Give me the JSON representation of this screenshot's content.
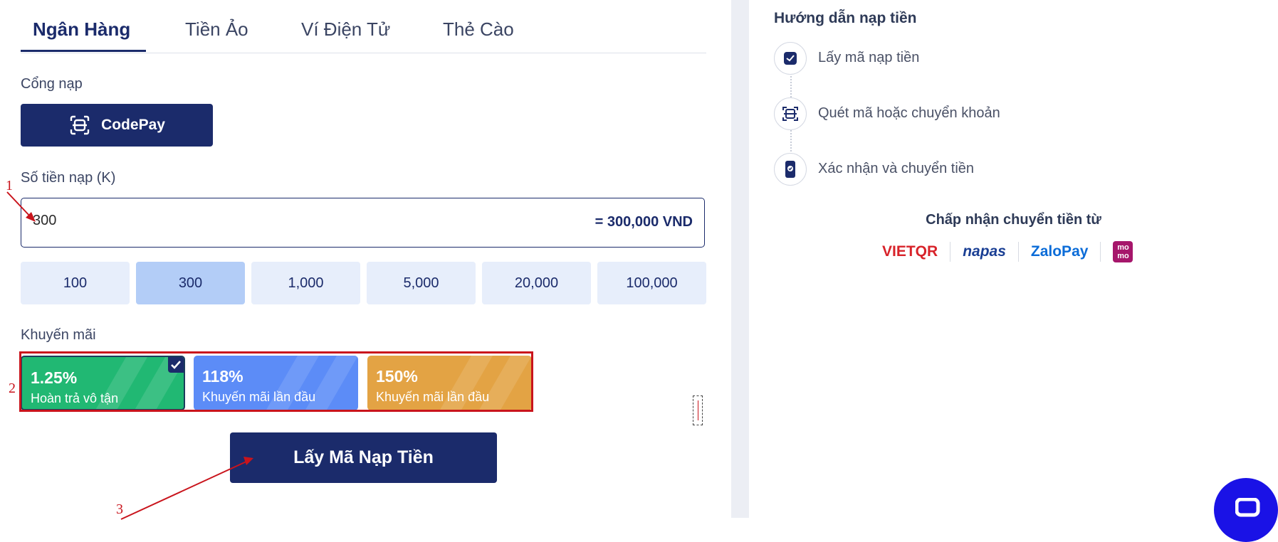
{
  "tabs": [
    {
      "label": "Ngân Hàng",
      "active": true
    },
    {
      "label": "Tiền Ảo",
      "active": false
    },
    {
      "label": "Ví Điện Tử",
      "active": false
    },
    {
      "label": "Thẻ Cào",
      "active": false
    }
  ],
  "gateway": {
    "label": "Cổng nạp",
    "button": "CodePay"
  },
  "amount": {
    "label": "Số tiền nạp (K)",
    "value": "300",
    "converted": "= 300,000 VND"
  },
  "presets": [
    {
      "label": "100",
      "selected": false
    },
    {
      "label": "300",
      "selected": true
    },
    {
      "label": "1,000",
      "selected": false
    },
    {
      "label": "5,000",
      "selected": false
    },
    {
      "label": "20,000",
      "selected": false
    },
    {
      "label": "100,000",
      "selected": false
    }
  ],
  "promotions": {
    "label": "Khuyến mãi",
    "items": [
      {
        "percent": "1.25%",
        "desc": "Hoàn trả vô tận",
        "color": "#21b873",
        "selected": true
      },
      {
        "percent": "118%",
        "desc": "Khuyến mãi lần đầu",
        "color": "#5c8cf7",
        "selected": false
      },
      {
        "percent": "150%",
        "desc": "Khuyến mãi lần đầu",
        "color": "#e3a344",
        "selected": false
      }
    ]
  },
  "submit": {
    "label": "Lấy Mã Nạp Tiền"
  },
  "annotations": [
    "1",
    "2",
    "3"
  ],
  "guide": {
    "title": "Hướng dẫn nạp tiền",
    "steps": [
      {
        "text": "Lấy mã nạp tiền",
        "icon": "clipboard-check-icon"
      },
      {
        "text": "Quét mã hoặc chuyển khoản",
        "icon": "scan-icon"
      },
      {
        "text": "Xác nhận và chuyển tiền",
        "icon": "phone-check-icon"
      }
    ]
  },
  "accept": {
    "title": "Chấp nhận chuyển tiền từ",
    "logos": [
      "VIETQR",
      "napas",
      "ZaloPay",
      "mo mo"
    ]
  },
  "colors": {
    "primary": "#1b2b6b",
    "annotation": "#c9141c",
    "preset_bg": "#e7eefb",
    "preset_selected": "#b3cdf7"
  }
}
